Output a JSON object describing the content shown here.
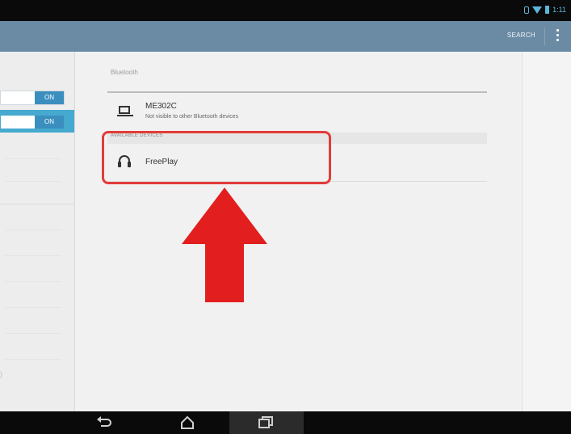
{
  "status_bar": {
    "time": "1:11"
  },
  "action_bar": {
    "button_label": "SEARCH"
  },
  "left_panel": {
    "toggles": [
      {
        "label": "ON",
        "selected": false
      },
      {
        "label": "ON",
        "selected": true
      }
    ],
    "corner_text": ")"
  },
  "main": {
    "section_title": "Bluetooth",
    "paired_device": {
      "name": "ME302C",
      "subtitle": "Not visible to other Bluetooth devices"
    },
    "available_header": "AVAILABLE DEVICES",
    "available_devices": [
      {
        "name": "FreePlay",
        "icon": "headphones-icon"
      }
    ]
  },
  "annotation": {
    "highlight_color": "#e23b3b",
    "arrow_color": "#e21e1e"
  },
  "colors": {
    "action_bar": "#6b8ba4",
    "accent": "#3a8fbf",
    "status_icons": "#5bb7d8"
  }
}
